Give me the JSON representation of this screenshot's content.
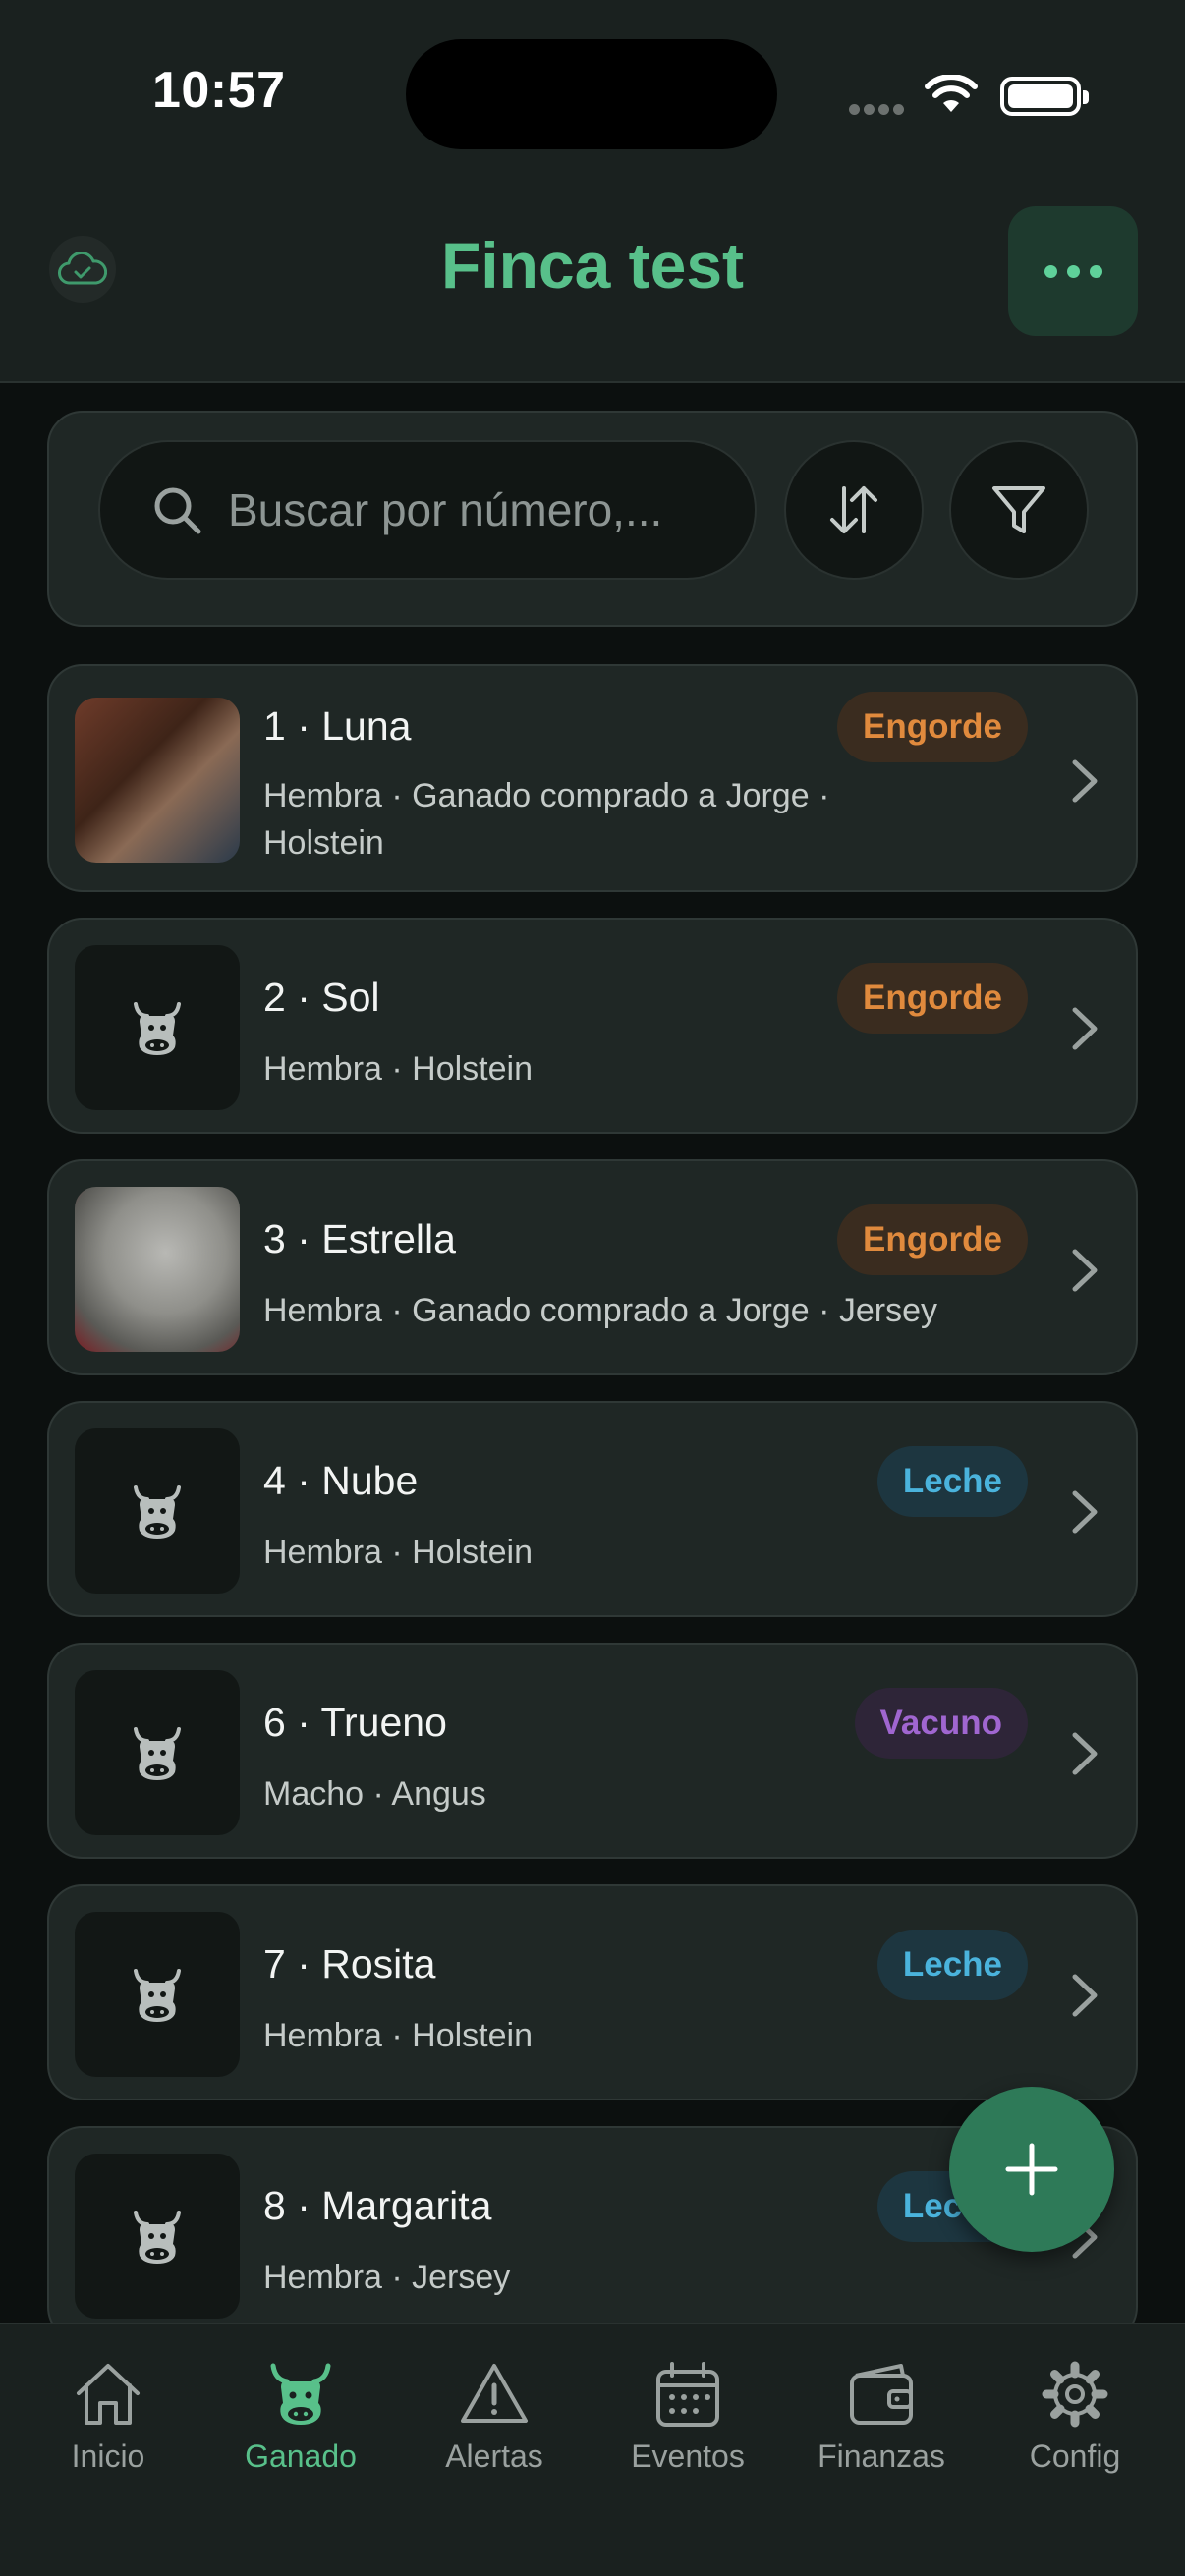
{
  "status_bar": {
    "time": "10:57"
  },
  "header": {
    "title": "Finca test"
  },
  "search": {
    "placeholder": "Buscar por número,..."
  },
  "animals": [
    {
      "title": "1 · Luna",
      "badge": "Engorde",
      "subtitle": "Hembra · Ganado comprado a Jorge · Holstein",
      "has_photo": true
    },
    {
      "title": "2 · Sol",
      "badge": "Engorde",
      "subtitle": "Hembra · Holstein",
      "has_photo": false
    },
    {
      "title": "3 · Estrella",
      "badge": "Engorde",
      "subtitle": "Hembra · Ganado comprado a Jorge · Jersey",
      "has_photo": true
    },
    {
      "title": "4 · Nube",
      "badge": "Leche",
      "subtitle": "Hembra · Holstein",
      "has_photo": false
    },
    {
      "title": "6 · Trueno",
      "badge": "Vacuno",
      "subtitle": "Macho · Angus",
      "has_photo": false
    },
    {
      "title": "7 · Rosita",
      "badge": "Leche",
      "subtitle": "Hembra · Holstein",
      "has_photo": false
    },
    {
      "title": "8 · Margarita",
      "badge": "Leche",
      "subtitle": "Hembra · Jersey",
      "has_photo": false
    }
  ],
  "tabs": [
    {
      "label": "Inicio",
      "icon": "home-icon"
    },
    {
      "label": "Ganado",
      "icon": "cow-icon",
      "active": true
    },
    {
      "label": "Alertas",
      "icon": "warning-icon"
    },
    {
      "label": "Eventos",
      "icon": "calendar-icon"
    },
    {
      "label": "Finanzas",
      "icon": "wallet-icon"
    },
    {
      "label": "Config",
      "icon": "gear-icon"
    }
  ],
  "colors": {
    "accent": "#58c08a",
    "engorde": "#e08a3d",
    "leche": "#4ab3dc",
    "vacuno": "#a066d0",
    "fab": "#2e7a58"
  }
}
